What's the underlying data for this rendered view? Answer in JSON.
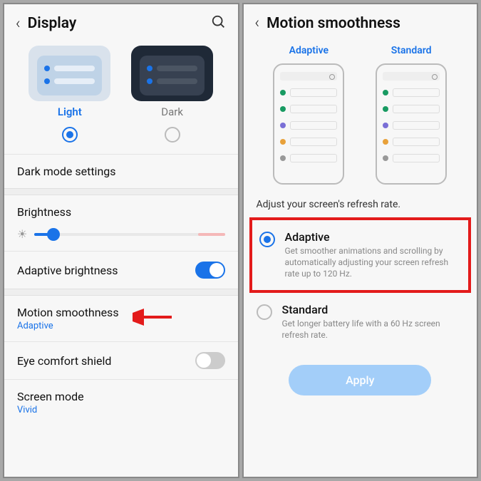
{
  "screen1": {
    "title": "Display",
    "themes": {
      "light_label": "Light",
      "dark_label": "Dark"
    },
    "dark_mode_settings": "Dark mode settings",
    "brightness_label": "Brightness",
    "adaptive_brightness": "Adaptive brightness",
    "motion_smoothness": {
      "label": "Motion smoothness",
      "value": "Adaptive"
    },
    "eye_comfort": "Eye comfort shield",
    "screen_mode": {
      "label": "Screen mode",
      "value": "Vivid"
    }
  },
  "screen2": {
    "title": "Motion smoothness",
    "illus": {
      "adaptive_label": "Adaptive",
      "standard_label": "Standard"
    },
    "subtitle": "Adjust your screen's refresh rate.",
    "options": {
      "adaptive": {
        "title": "Adaptive",
        "desc": "Get smoother animations and scrolling by automatically adjusting your screen refresh rate up to 120 Hz."
      },
      "standard": {
        "title": "Standard",
        "desc": "Get longer battery life with a 60 Hz screen refresh rate."
      }
    },
    "apply_label": "Apply"
  },
  "colors": {
    "accent": "#1a73e8",
    "highlight": "#e31b1b"
  }
}
